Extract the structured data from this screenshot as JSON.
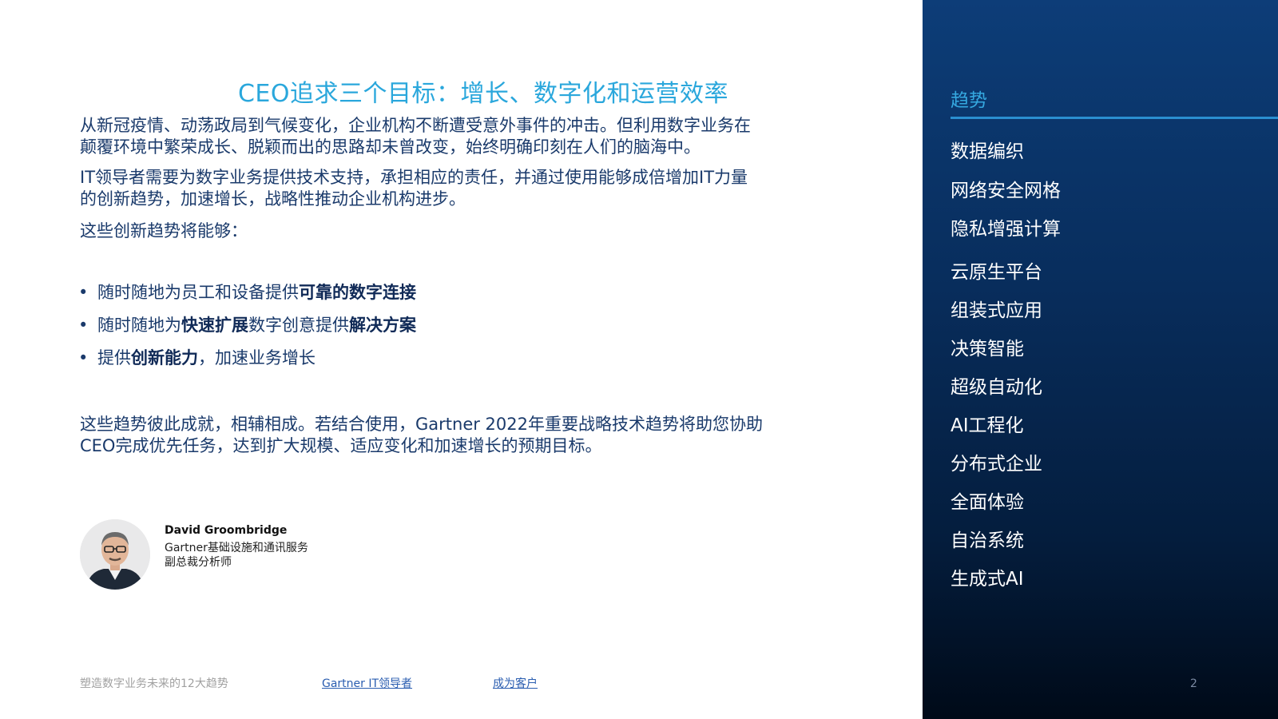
{
  "main": {
    "title": "CEO追求三个目标：增长、数字化和运营效率",
    "paragraph1_line1": "从新冠疫情、动荡政局到气候变化，企业机构不断遭受意外事件的冲击。但利用数字业务在",
    "paragraph1_line2": "颠覆环境中繁荣成长、脱颖而出的思路却未曾改变，始终明确印刻在人们的脑海中。",
    "paragraph2_line1": "IT领导者需要为数字业务提供技术支持，承担相应的责任，并通过使用能够成倍增加IT力量",
    "paragraph2_line2": "的创新趋势，加速增长，战略性推动企业机构进步。",
    "paragraph3": "这些创新趋势将能够：",
    "bullet_symbol": "•",
    "bullets": [
      {
        "pre": "随时随地为员工和设备提供",
        "bold1": "可靠的数字连接",
        "mid": "",
        "bold2": "",
        "post": ""
      },
      {
        "pre": "随时随地为",
        "bold1": "快速扩展",
        "mid": "数字创意提供",
        "bold2": "解决方案",
        "post": ""
      },
      {
        "pre": "提供",
        "bold1": "创新能力",
        "mid": "，加速业务增长",
        "bold2": "",
        "post": ""
      }
    ],
    "paragraph4_line1": "这些趋势彼此成就，相辅相成。若结合使用，Gartner 2022年重要战略技术趋势将助您协助",
    "paragraph4_line2": "CEO完成优先任务，达到扩大规模、适应变化和加速增长的预期目标。"
  },
  "author": {
    "name": "David Groombridge",
    "role_line1": "Gartner基础设施和通讯服务",
    "role_line2": "副总裁分析师"
  },
  "footer": {
    "doc_title": "塑造数字业务未来的12大趋势",
    "link1": "Gartner IT领导者",
    "link2": "成为客户"
  },
  "sidebar": {
    "heading": "趋势",
    "items": [
      "数据编织",
      "网络安全网格",
      "隐私增强计算",
      "云原生平台",
      "组装式应用",
      "决策智能",
      "超级自动化",
      "AI工程化",
      "分布式企业",
      "全面体验",
      "自治系统",
      "生成式AI"
    ],
    "page_number": "2"
  },
  "colors": {
    "title": "#2aa7dc",
    "body_text": "#1a3a6b",
    "sidebar_top": "#0d3d78",
    "sidebar_bottom": "#000a18",
    "sidebar_heading": "#35a8e0",
    "link": "#2a5db0"
  }
}
